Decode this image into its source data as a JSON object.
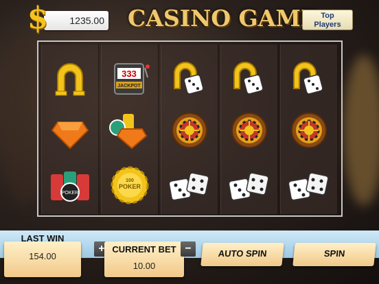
{
  "header": {
    "currency_icon": "$",
    "balance": "1235.00",
    "title": "CASINO GAME",
    "top_players_line1": "Top",
    "top_players_line2": "Players"
  },
  "reels": [
    [
      "horseshoe-icon",
      "diamond-icon",
      "poker-chips-icon"
    ],
    [
      "jackpot-slot-icon",
      "chips-diamond-icon",
      "poker-chip-icon"
    ],
    [
      "horseshoe-dice-icon",
      "roulette-icon",
      "dice-icon"
    ],
    [
      "horseshoe-dice-icon",
      "roulette-icon",
      "dice-icon"
    ],
    [
      "horseshoe-dice-icon",
      "roulette-icon",
      "dice-icon"
    ]
  ],
  "symbol_text": {
    "jackpot_digits": "333",
    "jackpot_word": "JACKPOT",
    "poker_word": "POKER",
    "chip_value": "100"
  },
  "controls": {
    "last_win_label": "LAST WIN",
    "last_win_value": "154.00",
    "bet_plus": "+",
    "current_bet_label": "CURRENT BET",
    "bet_minus": "−",
    "current_bet_value": "10.00",
    "auto_spin_label": "AUTO SPIN",
    "spin_label": "SPIN"
  },
  "colors": {
    "gold": "#f6c21a",
    "panel": "#f1c98a",
    "band": "#a9d2ea"
  }
}
